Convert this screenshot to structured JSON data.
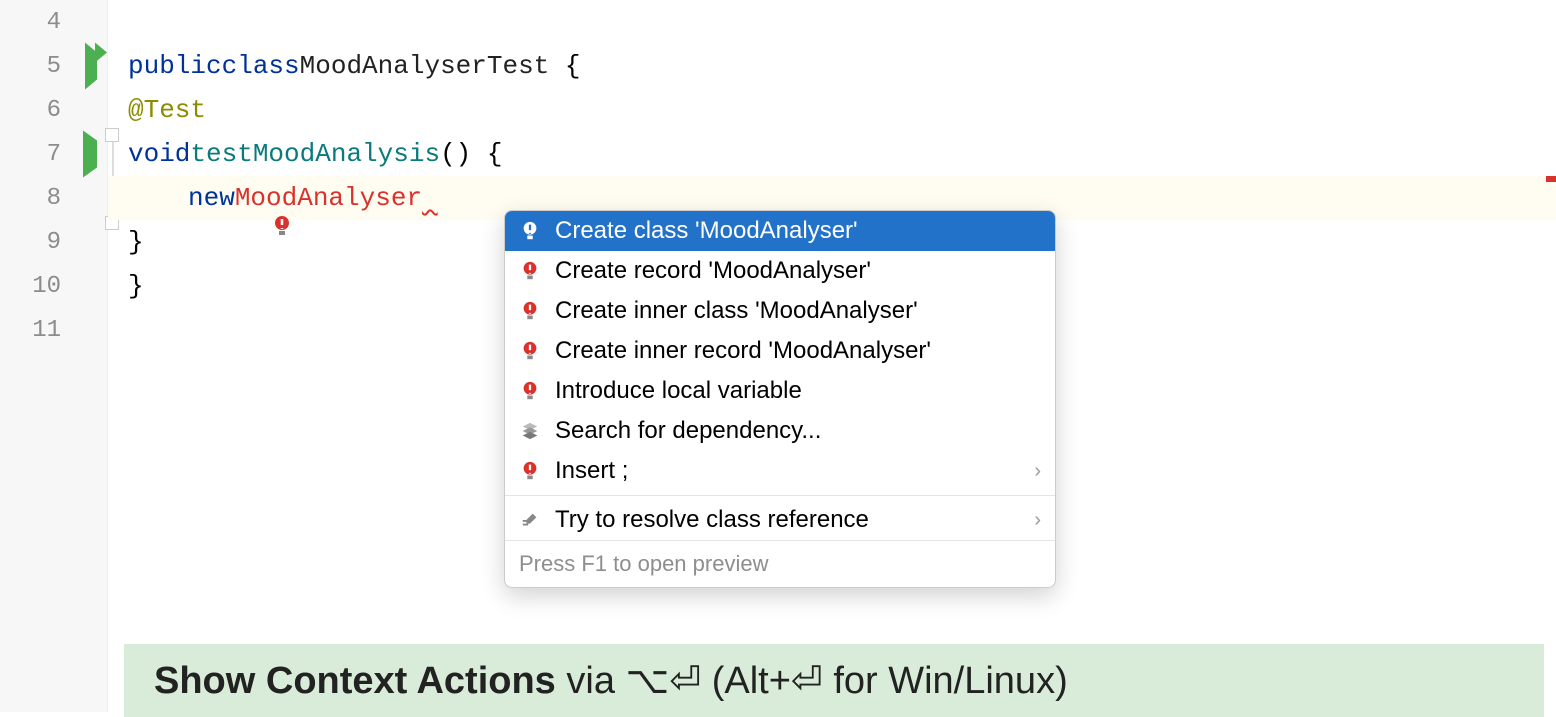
{
  "gutter": {
    "lines": [
      "4",
      "5",
      "6",
      "7",
      "8",
      "9",
      "10",
      "11"
    ]
  },
  "code": {
    "l5": {
      "public": "public",
      "class": "class",
      "name": "MoodAnalyserTest",
      "brace": " {"
    },
    "l6": {
      "anno": "@Test"
    },
    "l7": {
      "void": "void",
      "method": "testMoodAnalysis",
      "parens": "() {"
    },
    "l8": {
      "new": "new",
      "err": "MoodAnalyser"
    },
    "l9": {
      "brace": "}"
    },
    "l10": {
      "brace": "}"
    }
  },
  "popup": {
    "items": [
      {
        "label": "Create class 'MoodAnalyser'",
        "icon": "bulb-red",
        "selected": true
      },
      {
        "label": "Create record 'MoodAnalyser'",
        "icon": "bulb-red"
      },
      {
        "label": "Create inner class 'MoodAnalyser'",
        "icon": "bulb-red"
      },
      {
        "label": "Create inner record 'MoodAnalyser'",
        "icon": "bulb-red"
      },
      {
        "label": "Introduce local variable",
        "icon": "bulb-red"
      },
      {
        "label": "Search for dependency...",
        "icon": "stack"
      },
      {
        "label": "Insert ;",
        "icon": "bulb-red",
        "chev": true
      },
      {
        "sep": true
      },
      {
        "label": "Try to resolve class reference",
        "icon": "pencil",
        "chev": true
      }
    ],
    "footer": "Press F1 to open preview"
  },
  "hint": {
    "bold": "Show Context Actions",
    "rest1": " via ",
    "shortcut_mac": "⌥⏎",
    "rest2": " (Alt+",
    "enter": "⏎",
    "rest3": " for Win/Linux)"
  }
}
